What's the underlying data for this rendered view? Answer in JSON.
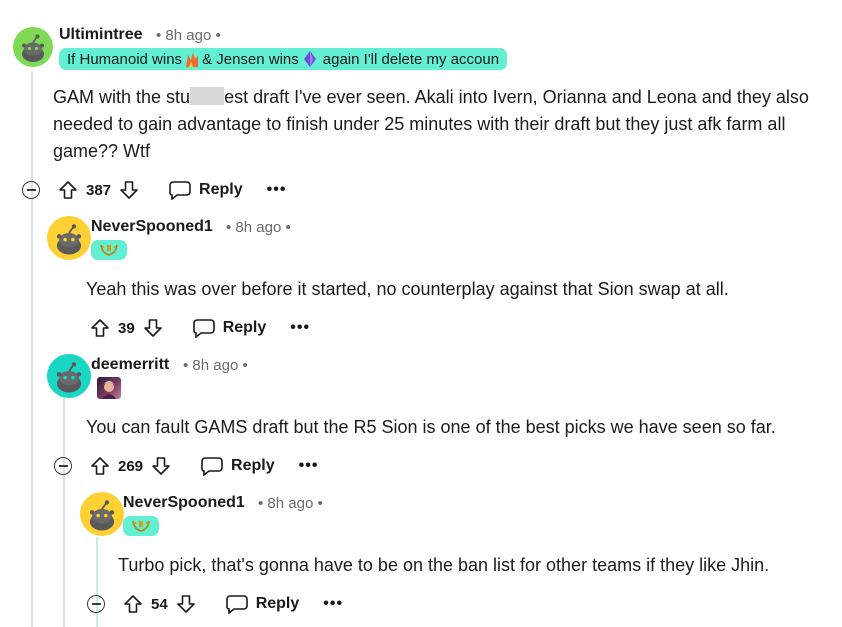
{
  "comments": [
    {
      "username": "Ultimintree",
      "time": "• 8h ago •",
      "flair_parts": [
        "If Humanoid wins",
        "& Jensen wins",
        "again I'll delete my accoun"
      ],
      "body_pre": "GAM with the stu",
      "body_post": "est draft I've ever seen. Akali into Ivern, Orianna and Leona and they also needed to gain advantage to finish under 25 minutes with their draft but they just afk farm all game?? Wtf",
      "score": "387",
      "reply": "Reply",
      "more": "•••",
      "avatar_color": "#7ed957"
    },
    {
      "username": "NeverSpooned1",
      "time": "• 8h ago •",
      "body": "Yeah this was over before it started, no counterplay against that Sion swap at all.",
      "score": "39",
      "reply": "Reply",
      "more": "•••",
      "avatar_color": "#ffd033"
    },
    {
      "username": "deemerritt",
      "time": "• 8h ago •",
      "body": "You can fault GAMS draft but the R5 Sion is one of the best picks we have seen so far.",
      "score": "269",
      "reply": "Reply",
      "more": "•••",
      "avatar_color": "#1ad7c4"
    },
    {
      "username": "NeverSpooned1",
      "time": "• 8h ago •",
      "body": "Turbo pick, that's gonna have to be on the ban list for other teams if they like Jhin.",
      "score": "54",
      "reply": "Reply",
      "more": "•••",
      "avatar_color": "#ffd033"
    }
  ],
  "colors": {
    "flair_bg": "#62efd3",
    "thread_line": "#c9ecea",
    "meta_text": "#6b6b6b"
  },
  "icons": [
    "snoo-avatar-icon",
    "upvote-icon",
    "downvote-icon",
    "comment-bubble-icon",
    "collapse-icon",
    "more-options-icon",
    "wreath-flair-icon",
    "champion-portrait-flair-icon"
  ]
}
